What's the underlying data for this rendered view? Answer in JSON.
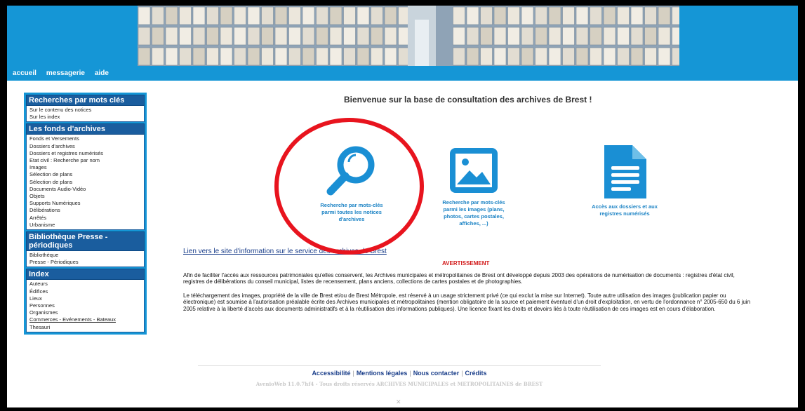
{
  "header": {
    "nav": [
      "accueil",
      "messagerie",
      "aide"
    ]
  },
  "sidebar": {
    "sections": [
      {
        "title": "Recherches par mots clés",
        "items": [
          "Sur le contenu des notices",
          "Sur les index"
        ]
      },
      {
        "title": "Les fonds d'archives",
        "items": [
          "Fonds et Versements",
          "Dossiers d'archives",
          "Dossiers et registres numérisés",
          "Etat civil : Recherche par nom",
          "Images",
          "Sélection de plans",
          "Sélection de plans",
          "Documents Audio-Vidéo",
          "Objets",
          "Supports Numériques",
          "Délibérations",
          "Arrêtés",
          "Urbanisme"
        ]
      },
      {
        "title": "Bibliothèque   Presse - périodiques",
        "items": [
          "Bibliothèque",
          "Presse - Périodiques"
        ]
      },
      {
        "title": "Index",
        "items": [
          "Auteurs",
          "Édifices",
          "Lieux",
          "Personnes",
          "Organismes",
          "Commerces - Evénements - Bateaux",
          "Thesauri"
        ]
      }
    ]
  },
  "main": {
    "welcome": "Bienvenue sur la base de consultation des archives de Brest !",
    "tiles": [
      {
        "icon": "search-icon",
        "lines": [
          "Recherche par mots-clés",
          "parmi toutes les notices",
          "d'archives"
        ]
      },
      {
        "icon": "image-icon",
        "lines": [
          "Recherche par mots-clés",
          "parmi les images (plans,",
          "photos, cartes postales,",
          "affiches, ...)"
        ]
      },
      {
        "icon": "document-icon",
        "lines": [
          "Accès aux dossiers et aux",
          "registres numérisés"
        ]
      }
    ],
    "info_link": "Lien vers le site d'information sur le service des archives de Brest",
    "warning_title": "AVERTISSEMENT",
    "paragraph1": "Afin de faciliter l'accès aux ressources patrimoniales qu'elles conservent, les Archives municipales et métropolitaines de Brest ont développé depuis 2003 des opérations de numérisation de documents : registres d'état civil, registres de délibérations du conseil municipal, listes de recensement, plans anciens, collections de cartes postales et de photographies.",
    "paragraph2": "Le téléchargement des images, propriété de la ville de Brest et/ou de Brest Métropole, est réservé à un usage strictement privé (ce qui exclut la mise sur Internet). Toute autre utilisation des images (publication papier ou électronique) est soumise à l'autorisation préalable écrite des Archives municipales et métropolitaines (mention obligatoire de la source et paiement éventuel d'un droit d'exploitation, en vertu de l'ordonnance n° 2005-650 du 6 juin 2005 relative à la liberté d'accès aux documents administratifs et à la réutilisation des informations publiques). Une licence fixant les droits et devoirs liés à toute réutilisation de ces images est en cours d'élaboration."
  },
  "footer": {
    "links": [
      "Accessibilité",
      "Mentions légales",
      "Nous contacter",
      "Crédits"
    ],
    "copyright": "AvenioWeb 11.0.7hf4 - Tous droits réservés ARCHIVES MUNICIPALES et METROPOLITAINES de BREST"
  },
  "colors": {
    "header": "#1596d6",
    "accent": "#1a82c4",
    "warning": "#d21818",
    "highlight_circle": "#e8141e"
  }
}
